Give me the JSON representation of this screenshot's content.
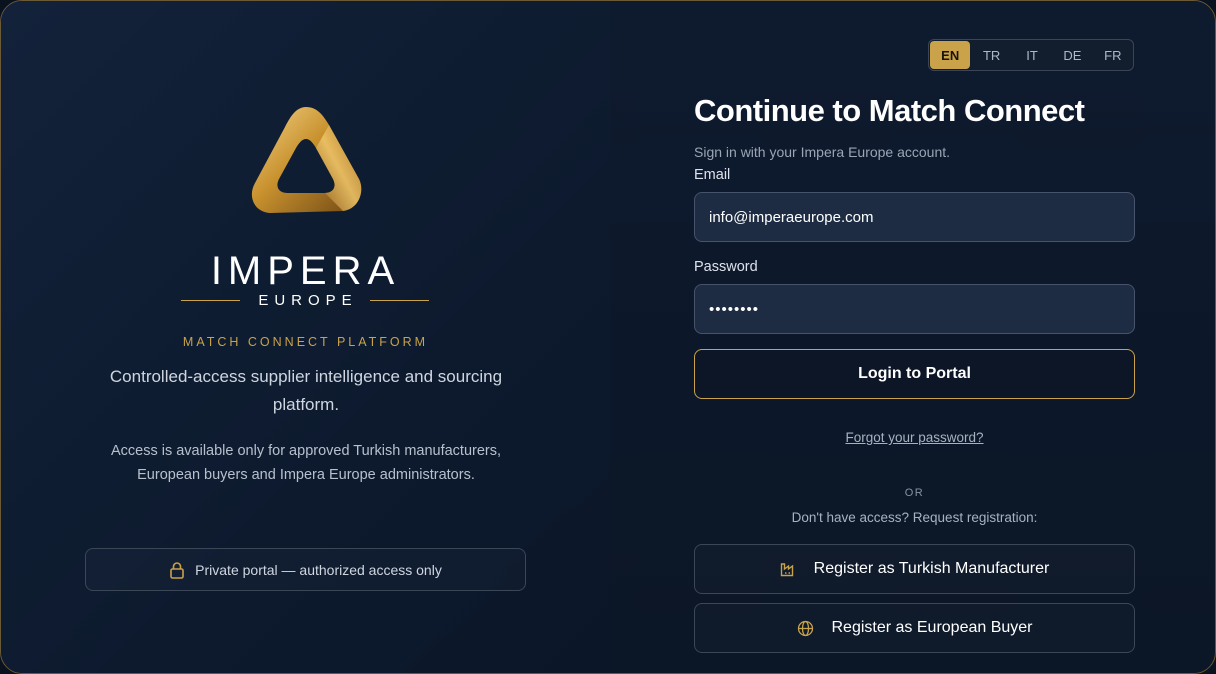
{
  "brand": {
    "name": "IMPERA",
    "sub": "EUROPE",
    "platform": "MATCH CONNECT PLATFORM",
    "tagline": "Controlled-access supplier intelligence and sourcing platform.",
    "access_note": "Access is available only for approved Turkish manufacturers, European buyers and Impera Europe administrators.",
    "private_notice": "Private portal — authorized access only"
  },
  "languages": [
    {
      "code": "EN",
      "active": true
    },
    {
      "code": "TR",
      "active": false
    },
    {
      "code": "IT",
      "active": false
    },
    {
      "code": "DE",
      "active": false
    },
    {
      "code": "FR",
      "active": false
    }
  ],
  "login": {
    "title": "Continue to Match Connect",
    "subtitle": "Sign in with your Impera Europe account.",
    "email_label": "Email",
    "email_value": "info@imperaeurope.com",
    "password_label": "Password",
    "password_value": "••••••••",
    "submit_label": "Login to Portal",
    "forgot_label": "Forgot your password?",
    "or_label": "OR",
    "request_label": "Don't have access? Request registration:",
    "register_manufacturer_label": "Register as Turkish Manufacturer",
    "register_buyer_label": "Register as European Buyer"
  },
  "icons": {
    "logo": "triangle-ribbon-logo",
    "lock": "lock-icon",
    "factory": "factory-icon",
    "globe": "globe-icon"
  },
  "colors": {
    "accent": "#c9a24a",
    "background": "#0c1728",
    "input_bg": "#1e2c43"
  }
}
